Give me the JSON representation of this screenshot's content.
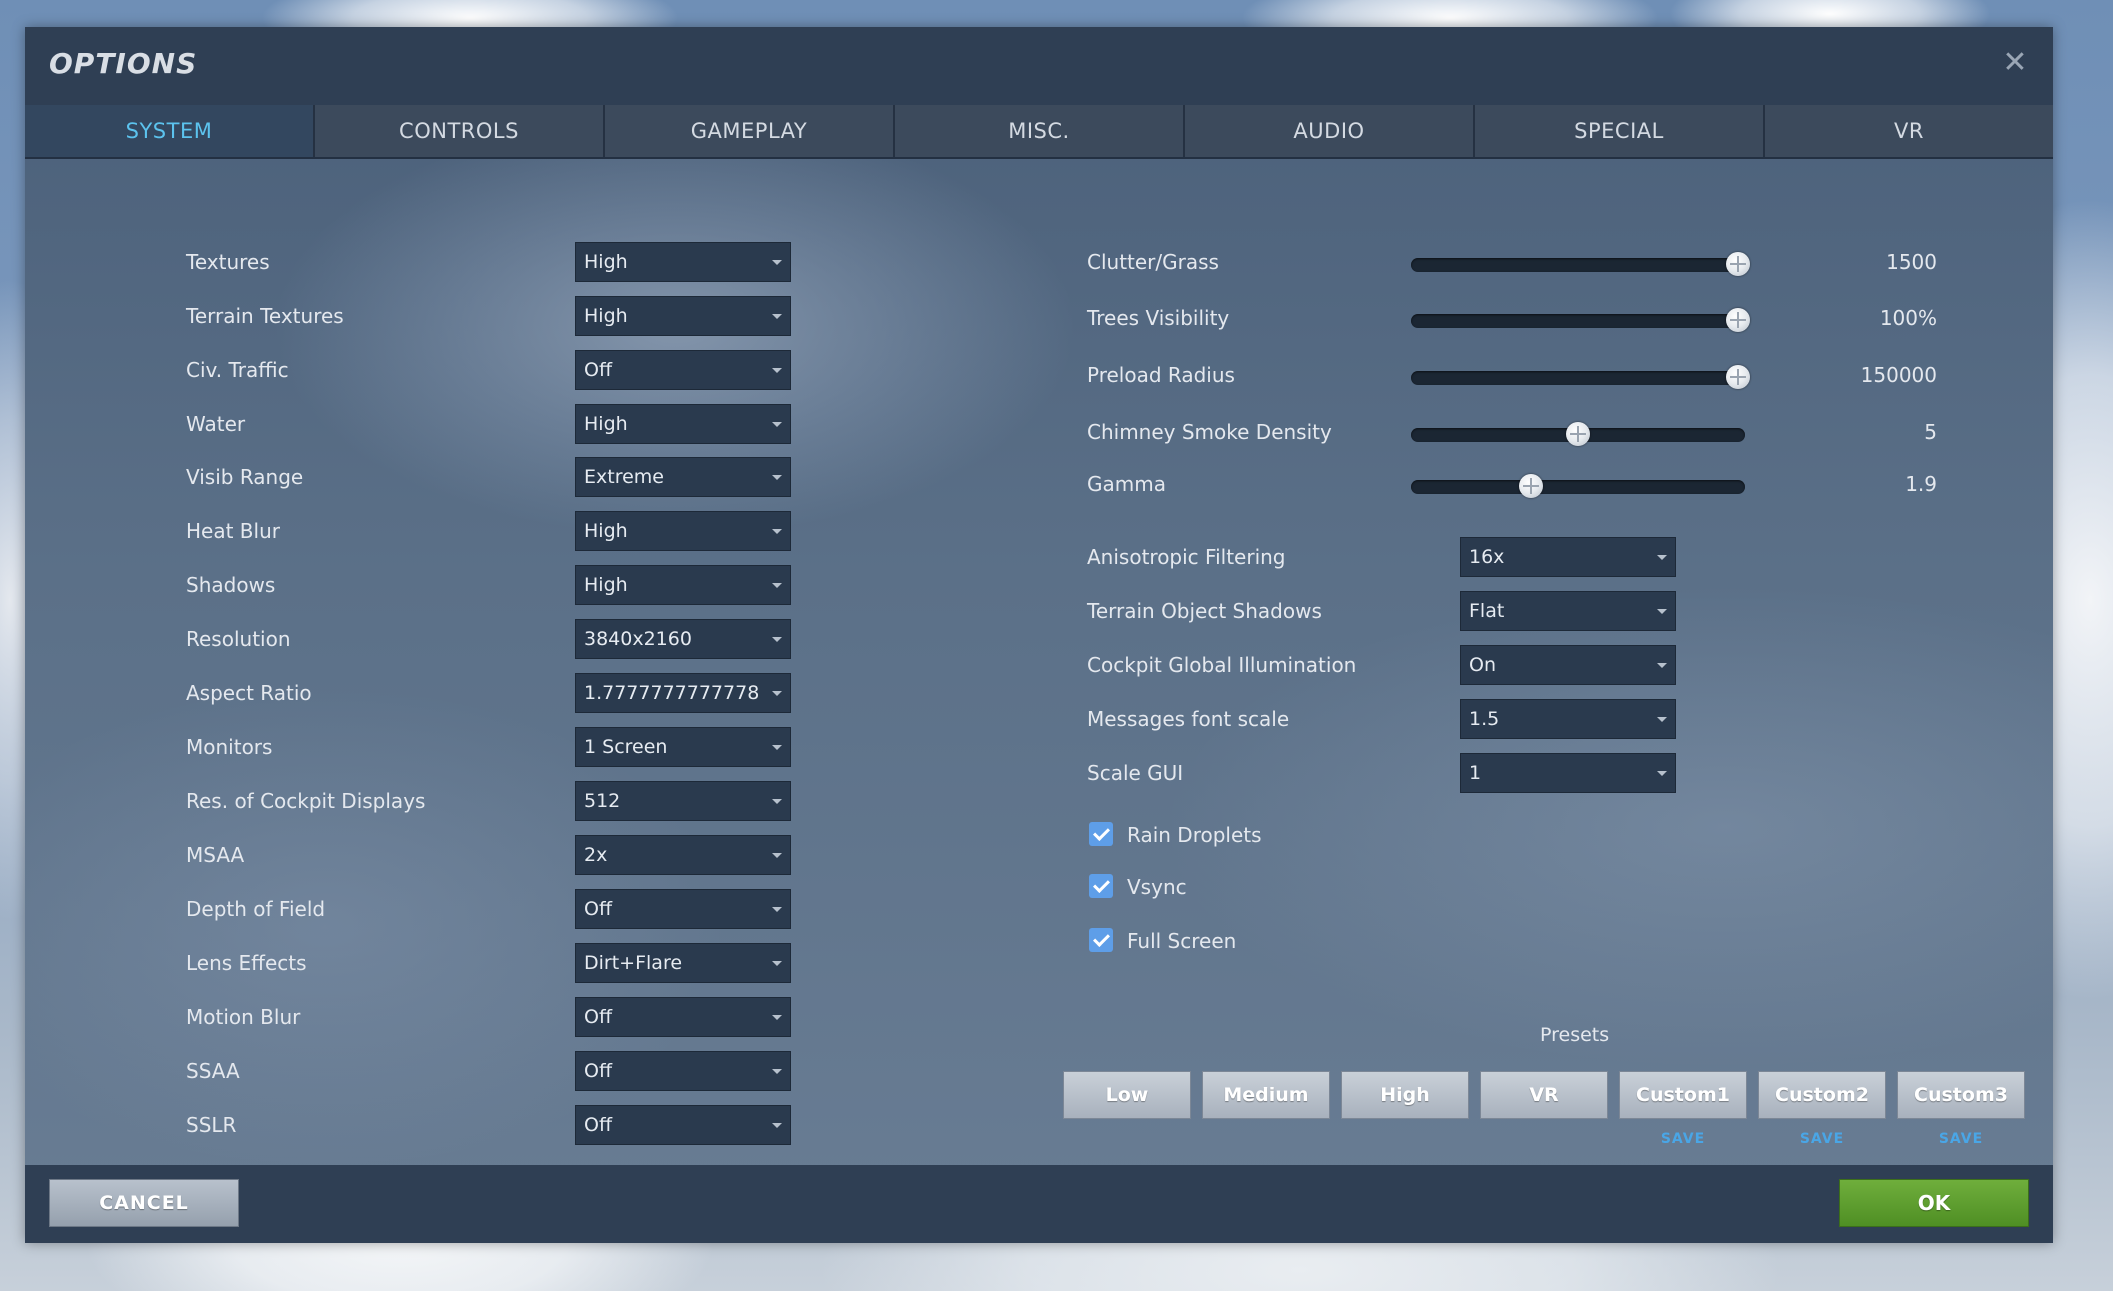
{
  "window": {
    "title": "OPTIONS"
  },
  "tabs": [
    {
      "label": "SYSTEM",
      "active": true
    },
    {
      "label": "CONTROLS"
    },
    {
      "label": "GAMEPLAY"
    },
    {
      "label": "MISC."
    },
    {
      "label": "AUDIO"
    },
    {
      "label": "SPECIAL"
    },
    {
      "label": "VR"
    }
  ],
  "left_settings": [
    {
      "label": "Textures",
      "value": "High"
    },
    {
      "label": "Terrain Textures",
      "value": "High"
    },
    {
      "label": "Civ. Traffic",
      "value": "Off"
    },
    {
      "label": "Water",
      "value": "High"
    },
    {
      "label": "Visib Range",
      "value": "Extreme"
    },
    {
      "label": "Heat Blur",
      "value": "High"
    },
    {
      "label": "Shadows",
      "value": "High"
    },
    {
      "label": "Resolution",
      "value": "3840x2160"
    },
    {
      "label": "Aspect Ratio",
      "value": "1.7777777777778"
    },
    {
      "label": "Monitors",
      "value": "1 Screen"
    },
    {
      "label": "Res. of Cockpit Displays",
      "value": "512"
    },
    {
      "label": "MSAA",
      "value": "2x"
    },
    {
      "label": "Depth of Field",
      "value": "Off"
    },
    {
      "label": "Lens Effects",
      "value": "Dirt+Flare"
    },
    {
      "label": "Motion Blur",
      "value": "Off"
    },
    {
      "label": "SSAA",
      "value": "Off"
    },
    {
      "label": "SSLR",
      "value": "Off"
    }
  ],
  "sliders": [
    {
      "label": "Clutter/Grass",
      "value": "1500",
      "fraction": 0.98
    },
    {
      "label": "Trees Visibility",
      "value": "100%",
      "fraction": 0.98
    },
    {
      "label": "Preload Radius",
      "value": "150000",
      "fraction": 0.98
    },
    {
      "label": "Chimney Smoke Density",
      "value": "5",
      "fraction": 0.5
    },
    {
      "label": "Gamma",
      "value": "1.9",
      "fraction": 0.36
    }
  ],
  "right_settings": [
    {
      "label": "Anisotropic Filtering",
      "value": "16x"
    },
    {
      "label": "Terrain Object Shadows",
      "value": "Flat"
    },
    {
      "label": "Cockpit Global Illumination",
      "value": "On"
    },
    {
      "label": "Messages font scale",
      "value": "1.5"
    },
    {
      "label": "Scale GUI",
      "value": "1"
    }
  ],
  "checkboxes": [
    {
      "label": "Rain Droplets",
      "checked": true
    },
    {
      "label": "Vsync",
      "checked": true
    },
    {
      "label": "Full Screen",
      "checked": true
    }
  ],
  "presets": {
    "label": "Presets",
    "buttons": [
      "Low",
      "Medium",
      "High",
      "VR",
      "Custom1",
      "Custom2",
      "Custom3"
    ],
    "save_label": "SAVE"
  },
  "footer": {
    "cancel_label": "CANCEL",
    "ok_label": "OK"
  },
  "colors": {
    "accent": "#5cc3ee",
    "ok": "#5a9a2e",
    "checkbox": "#5e9ee8"
  }
}
